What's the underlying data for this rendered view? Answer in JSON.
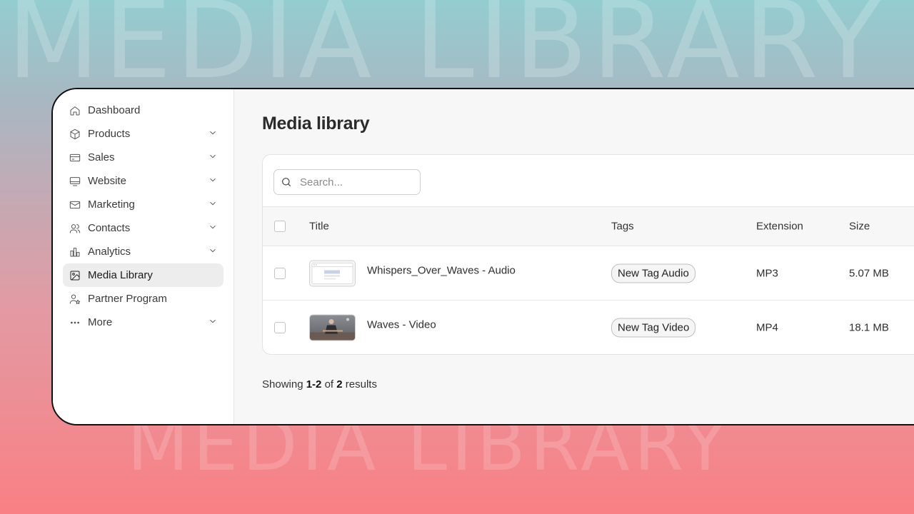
{
  "background_text": "MEDIA LIBRARY",
  "sidebar": {
    "items": [
      {
        "label": "Dashboard",
        "icon": "home-icon",
        "expandable": false,
        "active": false
      },
      {
        "label": "Products",
        "icon": "box-icon",
        "expandable": true,
        "active": false
      },
      {
        "label": "Sales",
        "icon": "credit-card-icon",
        "expandable": true,
        "active": false
      },
      {
        "label": "Website",
        "icon": "monitor-icon",
        "expandable": true,
        "active": false
      },
      {
        "label": "Marketing",
        "icon": "mail-icon",
        "expandable": true,
        "active": false
      },
      {
        "label": "Contacts",
        "icon": "users-icon",
        "expandable": true,
        "active": false
      },
      {
        "label": "Analytics",
        "icon": "bar-chart-icon",
        "expandable": true,
        "active": false
      },
      {
        "label": "Media Library",
        "icon": "image-icon",
        "expandable": false,
        "active": true
      },
      {
        "label": "Partner Program",
        "icon": "user-star-icon",
        "expandable": false,
        "active": false
      },
      {
        "label": "More",
        "icon": "more-dots-icon",
        "expandable": true,
        "active": false
      }
    ]
  },
  "main": {
    "title": "Media library",
    "search": {
      "placeholder": "Search...",
      "value": ""
    },
    "table": {
      "headers": {
        "title": "Title",
        "tags": "Tags",
        "extension": "Extension",
        "size": "Size"
      },
      "rows": [
        {
          "title": "Whispers_Over_Waves - Audio",
          "tag": "New Tag Audio",
          "extension": "MP3",
          "size": "5.07 MB",
          "thumb": "audio-thumbnail"
        },
        {
          "title": "Waves - Video",
          "tag": "New Tag Video",
          "extension": "MP4",
          "size": "18.1 MB",
          "thumb": "video-thumbnail"
        }
      ]
    },
    "footer": {
      "prefix": "Showing",
      "range": "1-2",
      "of": "of",
      "total": "2",
      "suffix": "results"
    }
  },
  "colors": {
    "accent_bg_top": "#93cdd0",
    "accent_bg_bottom": "#f98084",
    "active_nav": "#ededed"
  }
}
